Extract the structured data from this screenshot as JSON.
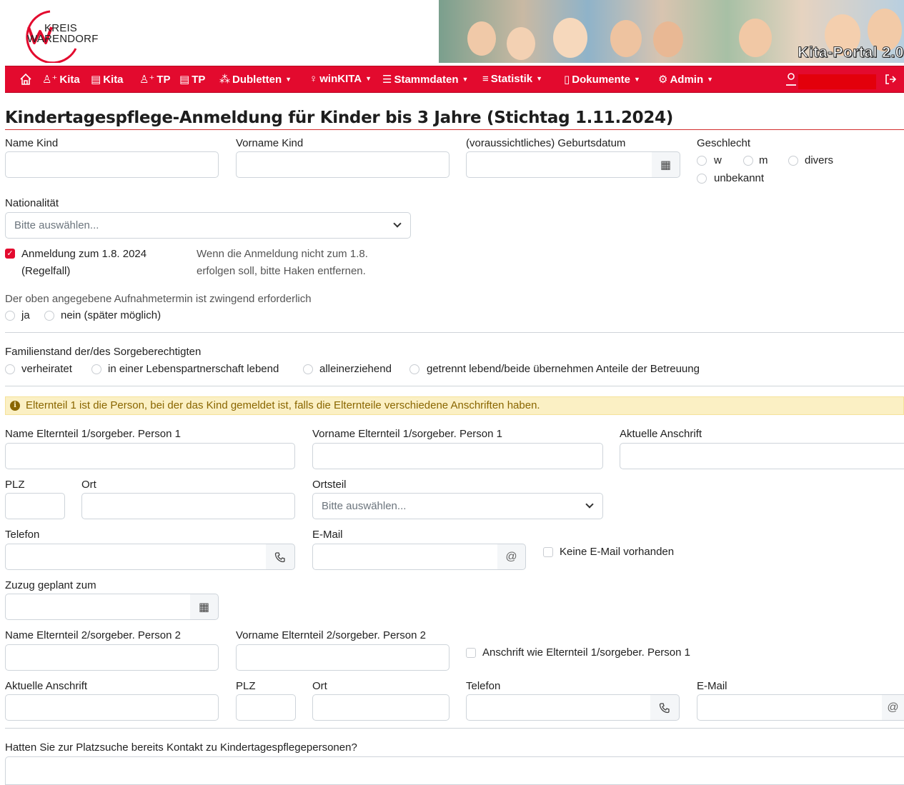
{
  "header": {
    "logo_line1": "KREIS",
    "logo_line2": "WARENDORF",
    "banner_title": "Kita-Portal 2.0",
    "brand_color": "#e30a2e"
  },
  "nav": {
    "home_icon": "home-icon",
    "items": [
      {
        "icon": "user-plus-icon",
        "label": "Kita"
      },
      {
        "icon": "table-icon",
        "label": "Kita"
      },
      {
        "icon": "user-plus-icon",
        "label": "TP"
      },
      {
        "icon": "table-icon",
        "label": "TP"
      },
      {
        "icon": "duplicate-icon",
        "label": "Dubletten"
      },
      {
        "icon": "child-icon",
        "label": "winKITA"
      },
      {
        "icon": "database-icon",
        "label": "Stammdaten"
      },
      {
        "icon": "chart-icon",
        "label": "Statistik"
      },
      {
        "icon": "document-icon",
        "label": "Dokumente"
      },
      {
        "icon": "gears-icon",
        "label": "Admin"
      }
    ],
    "user_icon": "user-icon",
    "logout_icon": "logout-icon"
  },
  "form": {
    "title": "Kindertagespflege-Anmeldung für Kinder bis 3 Jahre (Stichtag 1.11.2024)",
    "name_kind": "Name Kind",
    "vorname_kind": "Vorname Kind",
    "geburtsdatum": "(voraussichtliches) Geburtsdatum",
    "geschlecht": "Geschlecht",
    "geschlecht_options": [
      "w",
      "m",
      "divers",
      "unbekannt"
    ],
    "nationalitaet": "Nationalität",
    "select_placeholder": "Bitte auswählen...",
    "anmeldung_label_1": "Anmeldung zum 1.8. 2024",
    "anmeldung_label_2": "(Regelfall)",
    "anmeldung_hint_1": "Wenn die Anmeldung nicht zum 1.8.",
    "anmeldung_hint_2": "erfolgen soll, bitte Haken entfernen.",
    "aufnahme_question": "Der oben angegebene Aufnahmetermin ist zwingend erforderlich",
    "aufnahme_options": [
      "ja",
      "nein (später möglich)"
    ],
    "familienstand": "Familienstand der/des Sorgeberechtigten",
    "familienstand_options": [
      "verheiratet",
      "in einer Lebenspartnerschaft lebend",
      "alleinerziehend",
      "getrennt lebend/beide übernehmen Anteile der Betreuung"
    ],
    "alert": "Elternteil 1 ist die Person, bei der das Kind gemeldet ist, falls die Elternteile verschiedene Anschriften haben.",
    "p1_name": "Name Elternteil 1/sorgeber. Person 1",
    "p1_vorname": "Vorname Elternteil 1/sorgeber. Person 1",
    "p1_anschrift": "Aktuelle Anschrift",
    "plz": "PLZ",
    "ort": "Ort",
    "ortsteil": "Ortsteil",
    "telefon": "Telefon",
    "email": "E-Mail",
    "keine_email": "Keine E-Mail vorhanden",
    "zuzug": "Zuzug geplant zum",
    "p2_name": "Name Elternteil 2/sorgeber. Person 2",
    "p2_vorname": "Vorname Elternteil 2/sorgeber. Person 2",
    "p2_same_address": "Anschrift wie Elternteil 1/sorgeber. Person 1",
    "p2_anschrift": "Aktuelle Anschrift",
    "kontakt_question": "Hatten Sie zur Platzsuche bereits Kontakt zu Kindertagespflegepersonen?"
  }
}
